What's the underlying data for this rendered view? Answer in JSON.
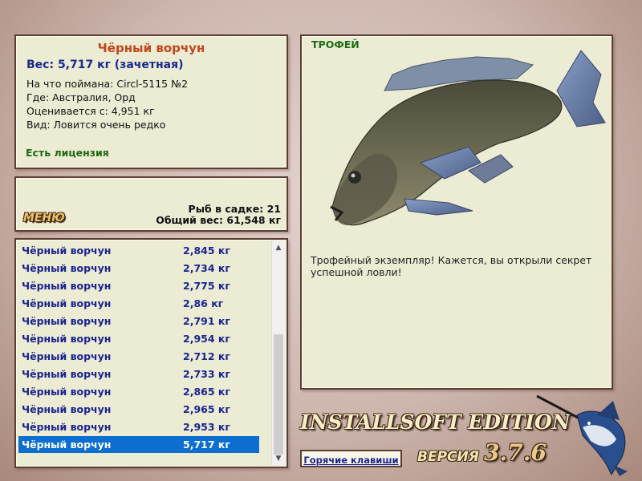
{
  "fish_info": {
    "name": "Чёрный ворчун",
    "weight": "Вес: 5,717 кг (зачетная)",
    "caught_with": "На что поймана: Circl-5115 №2",
    "location": "Где: Австралия, Орд",
    "valued_from": "Оценивается с: 4,951 кг",
    "rarity": "Вид: Ловится очень редко",
    "license": "Есть лицензия"
  },
  "stats": {
    "menu_label": "МЕНЮ",
    "fish_in_keepnet": "Рыб в садке: 21",
    "total_weight": "Общий вес: 61,548 кг"
  },
  "catch_list": {
    "rows": [
      {
        "name": "Чёрный ворчун",
        "weight": "2,845 кг"
      },
      {
        "name": "Чёрный ворчун",
        "weight": "2,734 кг"
      },
      {
        "name": "Чёрный ворчун",
        "weight": "2,775 кг"
      },
      {
        "name": "Чёрный ворчун",
        "weight": "2,86 кг"
      },
      {
        "name": "Чёрный ворчун",
        "weight": "2,791 кг"
      },
      {
        "name": "Чёрный ворчун",
        "weight": "2,954 кг"
      },
      {
        "name": "Чёрный ворчун",
        "weight": "2,712 кг"
      },
      {
        "name": "Чёрный ворчун",
        "weight": "2,733 кг"
      },
      {
        "name": "Чёрный ворчун",
        "weight": "2,865 кг"
      },
      {
        "name": "Чёрный ворчун",
        "weight": "2,965 кг"
      },
      {
        "name": "Чёрный ворчун",
        "weight": "2,953 кг"
      },
      {
        "name": "Чёрный ворчун",
        "weight": "5,717 кг"
      }
    ],
    "selected_index": 11
  },
  "trophy": {
    "label": "ТРОФЕЙ",
    "description": "Трофейный экземпляр! Кажется, вы открыли секрет успешной ловли!"
  },
  "branding": {
    "edition": "INSTALLSOFT EDITION",
    "version_label": "ВЕРСИЯ",
    "version_number": "3.7.6"
  },
  "hotkeys_label": "Горячие клавиши",
  "colors": {
    "title": "#c0461a",
    "weight": "#1a2a8c",
    "license": "#1d6b12",
    "selection": "#0c6fd0"
  },
  "icons": {
    "fish_image": "black-grunter-fish",
    "logo": "marlin-logo",
    "scroll_up": "chevron-up-icon",
    "scroll_down": "chevron-down-icon"
  }
}
